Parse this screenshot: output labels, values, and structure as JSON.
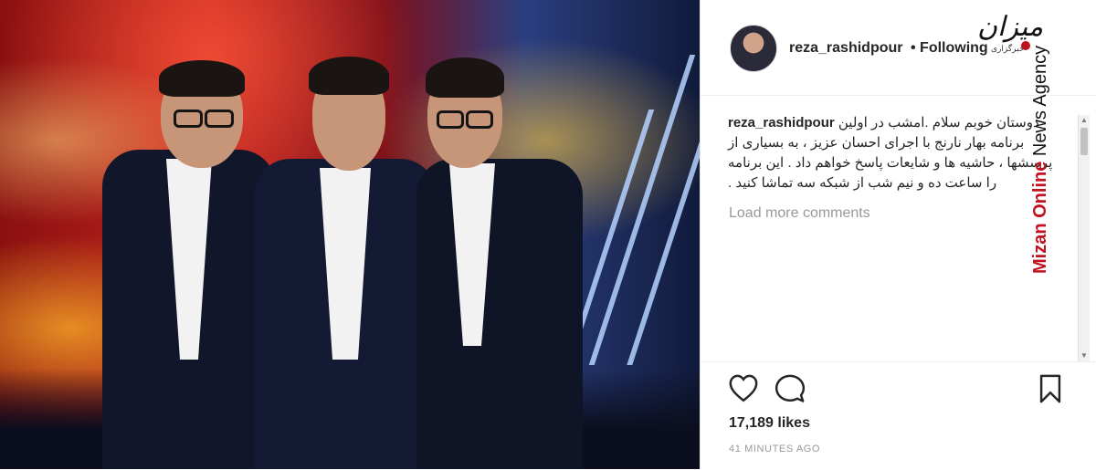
{
  "post": {
    "username": "reza_rashidpour",
    "follow_status": "• Following",
    "caption_user": "reza_rashidpour",
    "caption_text": "دوستان خوبم سلام .امشب در اولین برنامه بهار نارنج با اجرای احسان عزیز ، به بسیاری از پرسشها ، حاشیه ها و شایعات پاسخ خواهم داد . این برنامه را ساعت ده و نیم شب از شبکه سه تماشا کنید .",
    "load_more": "Load more comments",
    "likes": "17,189 likes",
    "time_ago": "41 MINUTES AGO"
  },
  "icons": {
    "like": "heart-icon",
    "comment": "comment-icon",
    "save": "bookmark-icon"
  },
  "watermark": {
    "agency_red": "Mizan Online",
    "agency_black": " News Agency",
    "logo_fa": "میزان",
    "logo_sub": "خبرگزاری"
  }
}
